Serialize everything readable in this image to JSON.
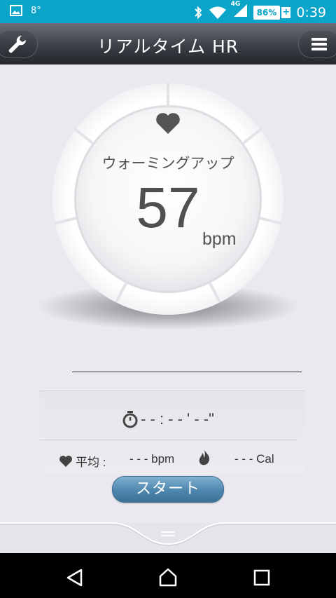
{
  "status_bar": {
    "notif_small": "8°",
    "network": "4G",
    "battery": "86%",
    "battery_plus": "+",
    "time": "0:39"
  },
  "header": {
    "title": "リアルタイム HR",
    "left_icon": "wrench-icon",
    "right_icon": "menu-icon"
  },
  "dial": {
    "zone": "ウォーミングアップ",
    "heart_rate": "57",
    "unit": "bpm"
  },
  "timer": {
    "value": "- - : - - ' - -\""
  },
  "stats": {
    "avg_label": "平均 :",
    "avg_value": "- - - bpm",
    "calories_value": "- - - Cal"
  },
  "actions": {
    "start_label": "スタート"
  },
  "colors": {
    "status_bar": "#0aa5c9",
    "start_button": "#4f86ad"
  }
}
